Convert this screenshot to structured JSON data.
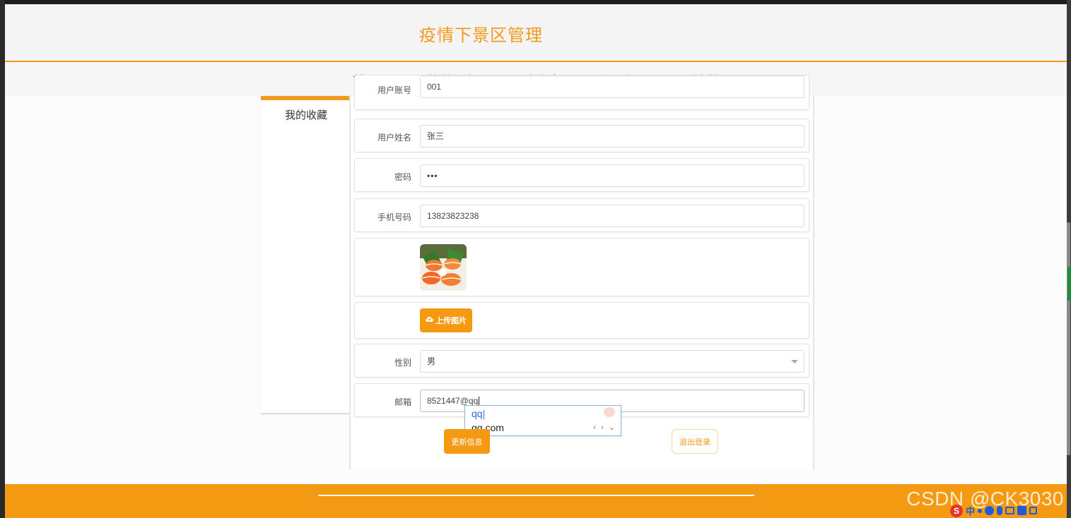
{
  "header": {
    "title": "疫情下景区管理"
  },
  "nav": {
    "items": [
      {
        "label": "首页"
      },
      {
        "label": "旅游景点"
      },
      {
        "label": "公告信息"
      },
      {
        "label": "个人中心",
        "active": true
      },
      {
        "label": "后台管理"
      }
    ]
  },
  "sidebar": {
    "items": [
      {
        "label": "我的收藏"
      }
    ]
  },
  "form": {
    "account": {
      "label": "用户账号",
      "value": "001"
    },
    "name": {
      "label": "用户姓名",
      "value": "张三"
    },
    "password": {
      "label": "密码",
      "value": "•••"
    },
    "phone": {
      "label": "手机号码",
      "value": "13823823238"
    },
    "upload_label": "上传图片",
    "gender": {
      "label": "性别",
      "value": "男"
    },
    "email": {
      "label": "邮箱",
      "value": "8521447@qq"
    }
  },
  "autocomplete": {
    "composing": "qq",
    "candidate": "qq.com",
    "arrows": "‹ › ⌄"
  },
  "actions": {
    "update_label": "更新信息",
    "logout_label": "退出登录"
  },
  "footer": {
    "watermark": "CSDN @CK3030"
  },
  "ime": {
    "mode": "中"
  },
  "colors": {
    "accent": "#f29a1b",
    "button": "#f49a12"
  }
}
